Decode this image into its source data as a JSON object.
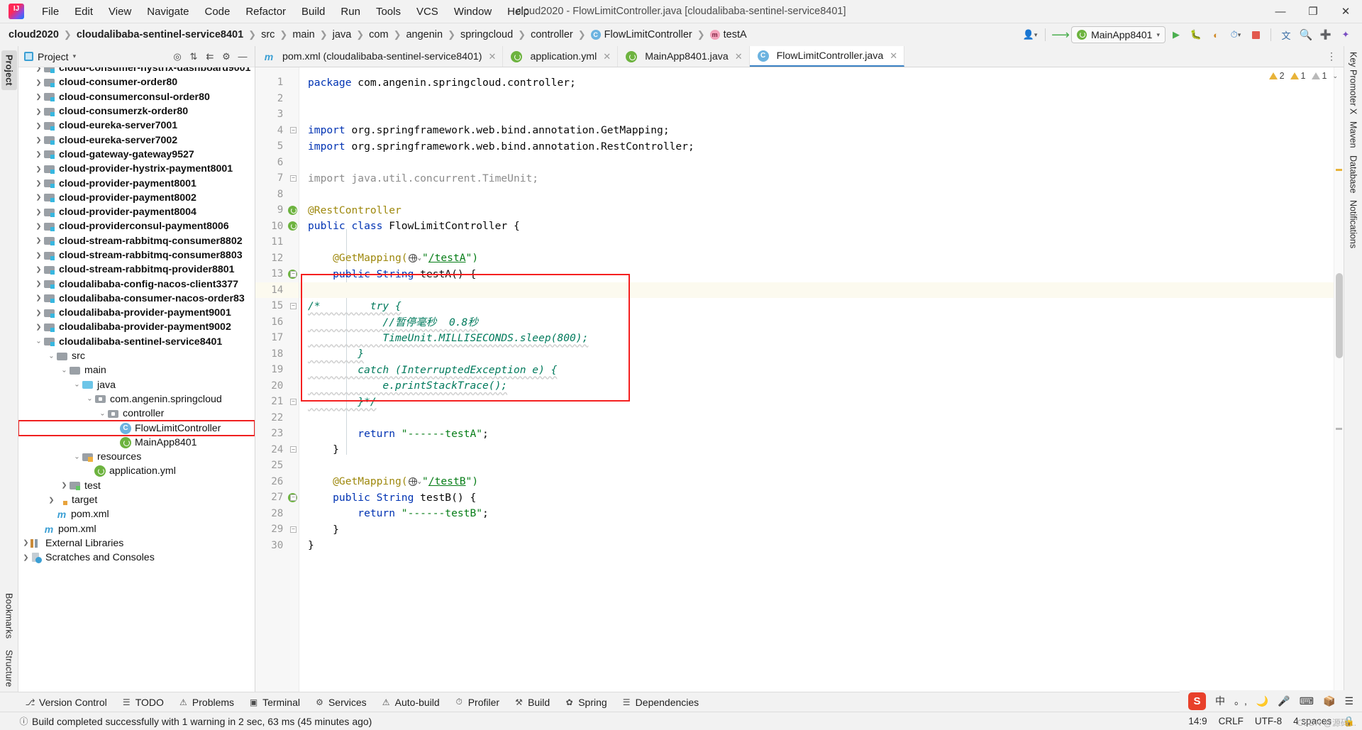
{
  "titlebar": {
    "logo_icon": "intellij-idea-logo",
    "window_title": "cloud2020 - FlowLimitController.java [cloudalibaba-sentinel-service8401]",
    "menus": [
      {
        "label": "File"
      },
      {
        "label": "Edit"
      },
      {
        "label": "View"
      },
      {
        "label": "Navigate"
      },
      {
        "label": "Code"
      },
      {
        "label": "Refactor"
      },
      {
        "label": "Build"
      },
      {
        "label": "Run"
      },
      {
        "label": "Tools"
      },
      {
        "label": "VCS"
      },
      {
        "label": "Window"
      },
      {
        "label": "Help"
      }
    ],
    "minimize": "—",
    "maximize": "❐",
    "close": "✕"
  },
  "navbar": {
    "crumbs": [
      {
        "label": "cloud2020",
        "bold": true,
        "icon": null
      },
      {
        "label": "cloudalibaba-sentinel-service8401",
        "bold": true,
        "icon": null
      },
      {
        "label": "src",
        "bold": false,
        "icon": null
      },
      {
        "label": "main",
        "bold": false,
        "icon": null
      },
      {
        "label": "java",
        "bold": false,
        "icon": null
      },
      {
        "label": "com",
        "bold": false,
        "icon": null
      },
      {
        "label": "angenin",
        "bold": false,
        "icon": null
      },
      {
        "label": "springcloud",
        "bold": false,
        "icon": null
      },
      {
        "label": "controller",
        "bold": false,
        "icon": null
      },
      {
        "label": "FlowLimitController",
        "bold": false,
        "icon": "class-icon",
        "badge": "C"
      },
      {
        "label": "testA",
        "bold": false,
        "icon": "method-icon",
        "badge": "m"
      }
    ],
    "separator": "❯",
    "run_config": "MainApp8401",
    "icons": {
      "user": "user-icon",
      "update": "update-project-icon",
      "run": "run-icon",
      "debug": "debug-icon",
      "coverage": "coverage-icon",
      "profiler": "profiler-icon",
      "stop": "stop-icon",
      "translate": "translate-icon",
      "search": "search-icon",
      "plus": "plus-icon",
      "assistant": "ai-assistant-icon"
    }
  },
  "left_rail": {
    "tabs": [
      "Project",
      "Bookmarks",
      "Structure"
    ]
  },
  "right_rail": {
    "tabs": [
      "Key Promoter X",
      "Maven",
      "Database",
      "Notifications"
    ]
  },
  "project_panel": {
    "title": "Project",
    "tools": [
      "locate-icon",
      "expand-all-icon",
      "collapse-all-icon",
      "settings-icon",
      "hide-icon"
    ],
    "tree": [
      {
        "label": "cloud-consumer-hystrix-dashboard9001",
        "depth": 1,
        "arrow": "❯",
        "icon": "module-folder",
        "bold": true,
        "clipped": true
      },
      {
        "label": "cloud-consumer-order80",
        "depth": 1,
        "arrow": "❯",
        "icon": "module-folder",
        "bold": true
      },
      {
        "label": "cloud-consumerconsul-order80",
        "depth": 1,
        "arrow": "❯",
        "icon": "module-folder",
        "bold": true
      },
      {
        "label": "cloud-consumerzk-order80",
        "depth": 1,
        "arrow": "❯",
        "icon": "module-folder",
        "bold": true
      },
      {
        "label": "cloud-eureka-server7001",
        "depth": 1,
        "arrow": "❯",
        "icon": "module-folder",
        "bold": true
      },
      {
        "label": "cloud-eureka-server7002",
        "depth": 1,
        "arrow": "❯",
        "icon": "module-folder",
        "bold": true
      },
      {
        "label": "cloud-gateway-gateway9527",
        "depth": 1,
        "arrow": "❯",
        "icon": "module-folder",
        "bold": true
      },
      {
        "label": "cloud-provider-hystrix-payment8001",
        "depth": 1,
        "arrow": "❯",
        "icon": "module-folder",
        "bold": true
      },
      {
        "label": "cloud-provider-payment8001",
        "depth": 1,
        "arrow": "❯",
        "icon": "module-folder",
        "bold": true
      },
      {
        "label": "cloud-provider-payment8002",
        "depth": 1,
        "arrow": "❯",
        "icon": "module-folder",
        "bold": true
      },
      {
        "label": "cloud-provider-payment8004",
        "depth": 1,
        "arrow": "❯",
        "icon": "module-folder",
        "bold": true
      },
      {
        "label": "cloud-providerconsul-payment8006",
        "depth": 1,
        "arrow": "❯",
        "icon": "module-folder",
        "bold": true
      },
      {
        "label": "cloud-stream-rabbitmq-consumer8802",
        "depth": 1,
        "arrow": "❯",
        "icon": "module-folder",
        "bold": true
      },
      {
        "label": "cloud-stream-rabbitmq-consumer8803",
        "depth": 1,
        "arrow": "❯",
        "icon": "module-folder",
        "bold": true
      },
      {
        "label": "cloud-stream-rabbitmq-provider8801",
        "depth": 1,
        "arrow": "❯",
        "icon": "module-folder",
        "bold": true
      },
      {
        "label": "cloudalibaba-config-nacos-client3377",
        "depth": 1,
        "arrow": "❯",
        "icon": "module-folder",
        "bold": true
      },
      {
        "label": "cloudalibaba-consumer-nacos-order83",
        "depth": 1,
        "arrow": "❯",
        "icon": "module-folder",
        "bold": true
      },
      {
        "label": "cloudalibaba-provider-payment9001",
        "depth": 1,
        "arrow": "❯",
        "icon": "module-folder",
        "bold": true
      },
      {
        "label": "cloudalibaba-provider-payment9002",
        "depth": 1,
        "arrow": "❯",
        "icon": "module-folder",
        "bold": true
      },
      {
        "label": "cloudalibaba-sentinel-service8401",
        "depth": 1,
        "arrow": "⌄",
        "icon": "module-folder",
        "bold": true,
        "expanded": true
      },
      {
        "label": "src",
        "depth": 2,
        "arrow": "⌄",
        "icon": "plain-folder",
        "bold": false
      },
      {
        "label": "main",
        "depth": 3,
        "arrow": "⌄",
        "icon": "plain-folder",
        "bold": false
      },
      {
        "label": "java",
        "depth": 4,
        "arrow": "⌄",
        "icon": "source-folder",
        "bold": false
      },
      {
        "label": "com.angenin.springcloud",
        "depth": 5,
        "arrow": "⌄",
        "icon": "package-folder",
        "bold": false
      },
      {
        "label": "controller",
        "depth": 6,
        "arrow": "⌄",
        "icon": "package-folder",
        "bold": false
      },
      {
        "label": "FlowLimitController",
        "depth": 7,
        "arrow": "",
        "icon": "java-class",
        "bold": false,
        "highlight": true
      },
      {
        "label": "MainApp8401",
        "depth": 7,
        "arrow": "",
        "icon": "spring-class",
        "bold": false
      },
      {
        "label": "resources",
        "depth": 4,
        "arrow": "⌄",
        "icon": "resources-folder",
        "bold": false
      },
      {
        "label": "application.yml",
        "depth": 5,
        "arrow": "",
        "icon": "spring-yaml",
        "bold": false
      },
      {
        "label": "test",
        "depth": 3,
        "arrow": "❯",
        "icon": "test-folder",
        "bold": false
      },
      {
        "label": "target",
        "depth": 2,
        "arrow": "❯",
        "icon": "target-folder",
        "bold": false
      },
      {
        "label": "pom.xml",
        "depth": 2,
        "arrow": "",
        "icon": "maven-file",
        "bold": false
      },
      {
        "label": "pom.xml",
        "depth": 1,
        "arrow": "",
        "icon": "maven-file",
        "bold": false
      },
      {
        "label": "External Libraries",
        "depth": 0,
        "arrow": "❯",
        "icon": "libraries",
        "bold": false
      },
      {
        "label": "Scratches and Consoles",
        "depth": 0,
        "arrow": "❯",
        "icon": "scratches",
        "bold": false
      }
    ]
  },
  "editor": {
    "tabs": [
      {
        "label": "pom.xml (cloudalibaba-sentinel-service8401)",
        "icon": "maven-icon",
        "active": false,
        "close": "✕"
      },
      {
        "label": "application.yml",
        "icon": "spring-yaml-icon",
        "active": false,
        "close": "✕"
      },
      {
        "label": "MainApp8401.java",
        "icon": "spring-class-icon",
        "active": false,
        "close": "✕"
      },
      {
        "label": "FlowLimitController.java",
        "icon": "java-class-icon",
        "active": true,
        "close": "✕"
      }
    ],
    "tab_overflow_icon": "more-tabs-icon",
    "inspections": {
      "warnings": "2",
      "weak_warnings": "1",
      "typos": "1",
      "expand_icon": "⌄"
    },
    "lines": [
      {
        "n": 1,
        "segs": [
          {
            "t": "package ",
            "c": "kw"
          },
          {
            "t": "com.angenin.springcloud.controller;",
            "c": "plain"
          }
        ]
      },
      {
        "n": 2,
        "segs": []
      },
      {
        "n": 3,
        "segs": []
      },
      {
        "n": 4,
        "segs": [
          {
            "t": "import ",
            "c": "kw"
          },
          {
            "t": "org.springframework.web.bind.annotation.",
            "c": "plain"
          },
          {
            "t": "GetMapping",
            "c": "plain"
          },
          {
            "t": ";",
            "c": "plain"
          }
        ],
        "fold": "minus"
      },
      {
        "n": 5,
        "segs": [
          {
            "t": "import ",
            "c": "kw"
          },
          {
            "t": "org.springframework.web.bind.annotation.",
            "c": "plain"
          },
          {
            "t": "RestController",
            "c": "plain"
          },
          {
            "t": ";",
            "c": "plain"
          }
        ]
      },
      {
        "n": 6,
        "segs": []
      },
      {
        "n": 7,
        "segs": [
          {
            "t": "import java.util.concurrent.TimeUnit;",
            "c": "cmt"
          }
        ],
        "fold": "minus"
      },
      {
        "n": 8,
        "segs": []
      },
      {
        "n": 9,
        "segs": [
          {
            "t": "@RestController",
            "c": "ann"
          }
        ],
        "gicon": "bean"
      },
      {
        "n": 10,
        "segs": [
          {
            "t": "public class ",
            "c": "kw"
          },
          {
            "t": "FlowLimitController",
            "c": "plain"
          },
          {
            "t": " {",
            "c": "plain"
          }
        ],
        "gicon": "bean"
      },
      {
        "n": 11,
        "segs": []
      },
      {
        "n": 12,
        "segs": [
          {
            "t": "    @GetMapping(",
            "c": "ann"
          },
          {
            "t": "GLOBE",
            "c": "icon"
          },
          {
            "t": "\"",
            "c": "str"
          },
          {
            "t": "/testA",
            "c": "lnk"
          },
          {
            "t": "\")",
            "c": "str"
          }
        ]
      },
      {
        "n": 13,
        "segs": [
          {
            "t": "    public String ",
            "c": "kw"
          },
          {
            "t": "testA() {",
            "c": "plain"
          }
        ],
        "gicon": "bean",
        "fold": "minus"
      },
      {
        "n": 14,
        "segs": [],
        "hl": true
      },
      {
        "n": 15,
        "segs": [
          {
            "t": "/*        try {",
            "c": "grn"
          }
        ],
        "fold": "minus"
      },
      {
        "n": 16,
        "segs": [
          {
            "t": "            //暂停毫秒  0.8秒",
            "c": "grn"
          }
        ]
      },
      {
        "n": 17,
        "segs": [
          {
            "t": "            TimeUnit.MILLISECONDS.sleep(800);",
            "c": "grn"
          }
        ]
      },
      {
        "n": 18,
        "segs": [
          {
            "t": "        }",
            "c": "grn"
          }
        ]
      },
      {
        "n": 19,
        "segs": [
          {
            "t": "        catch (InterruptedException e) {",
            "c": "grn"
          }
        ]
      },
      {
        "n": 20,
        "segs": [
          {
            "t": "            e.printStackTrace();",
            "c": "grn"
          }
        ]
      },
      {
        "n": 21,
        "segs": [
          {
            "t": "        }*/",
            "c": "grn"
          }
        ],
        "fold": "minus"
      },
      {
        "n": 22,
        "segs": []
      },
      {
        "n": 23,
        "segs": [
          {
            "t": "        return ",
            "c": "kw"
          },
          {
            "t": "\"------testA\"",
            "c": "str"
          },
          {
            "t": ";",
            "c": "plain"
          }
        ]
      },
      {
        "n": 24,
        "segs": [
          {
            "t": "    }",
            "c": "plain"
          }
        ],
        "fold": "minus"
      },
      {
        "n": 25,
        "segs": []
      },
      {
        "n": 26,
        "segs": [
          {
            "t": "    @GetMapping(",
            "c": "ann"
          },
          {
            "t": "GLOBE",
            "c": "icon"
          },
          {
            "t": "\"",
            "c": "str"
          },
          {
            "t": "/testB",
            "c": "lnk"
          },
          {
            "t": "\")",
            "c": "str"
          }
        ]
      },
      {
        "n": 27,
        "segs": [
          {
            "t": "    public String ",
            "c": "kw"
          },
          {
            "t": "testB() {",
            "c": "plain"
          }
        ],
        "gicon": "bean",
        "fold": "minus"
      },
      {
        "n": 28,
        "segs": [
          {
            "t": "        return ",
            "c": "kw"
          },
          {
            "t": "\"------testB\"",
            "c": "str"
          },
          {
            "t": ";",
            "c": "plain"
          }
        ]
      },
      {
        "n": 29,
        "segs": [
          {
            "t": "    }",
            "c": "plain"
          }
        ],
        "fold": "minus"
      },
      {
        "n": 30,
        "segs": [
          {
            "t": "}",
            "c": "plain"
          }
        ]
      }
    ]
  },
  "tool_windows": [
    {
      "label": "Version Control",
      "icon": "branch-icon"
    },
    {
      "label": "TODO",
      "icon": "todo-icon"
    },
    {
      "label": "Problems",
      "icon": "problems-icon"
    },
    {
      "label": "Terminal",
      "icon": "terminal-icon"
    },
    {
      "label": "Services",
      "icon": "services-icon"
    },
    {
      "label": "Auto-build",
      "icon": "autobuild-icon"
    },
    {
      "label": "Profiler",
      "icon": "profiler-icon"
    },
    {
      "label": "Build",
      "icon": "build-icon"
    },
    {
      "label": "Spring",
      "icon": "spring-icon"
    },
    {
      "label": "Dependencies",
      "icon": "dependencies-icon"
    }
  ],
  "statusbar": {
    "message": "Build completed successfully with 1 warning in 2 sec, 63 ms (45 minutes ago)",
    "message_icon": "info-icon",
    "caret_position": "14:9",
    "line_separator": "CRLF",
    "encoding": "UTF-8",
    "indent": "4 spaces",
    "lock_icon": "lock-icon",
    "watermark": "CSDN @源码..."
  },
  "ime": {
    "sogou_icon": "sogou-input-icon",
    "items": [
      "中",
      "。,",
      "🌙",
      "🎤",
      "⌨",
      "📦",
      "☰"
    ]
  },
  "colors": {
    "accent_blue": "#3b82c4",
    "red_highlight": "#f52020",
    "keyword": "#0033b3",
    "string": "#067d17",
    "comment_green": "#007a5c",
    "annotation": "#9e880d",
    "panel_bg": "#f2f2f2",
    "editor_bg": "#ffffff"
  }
}
